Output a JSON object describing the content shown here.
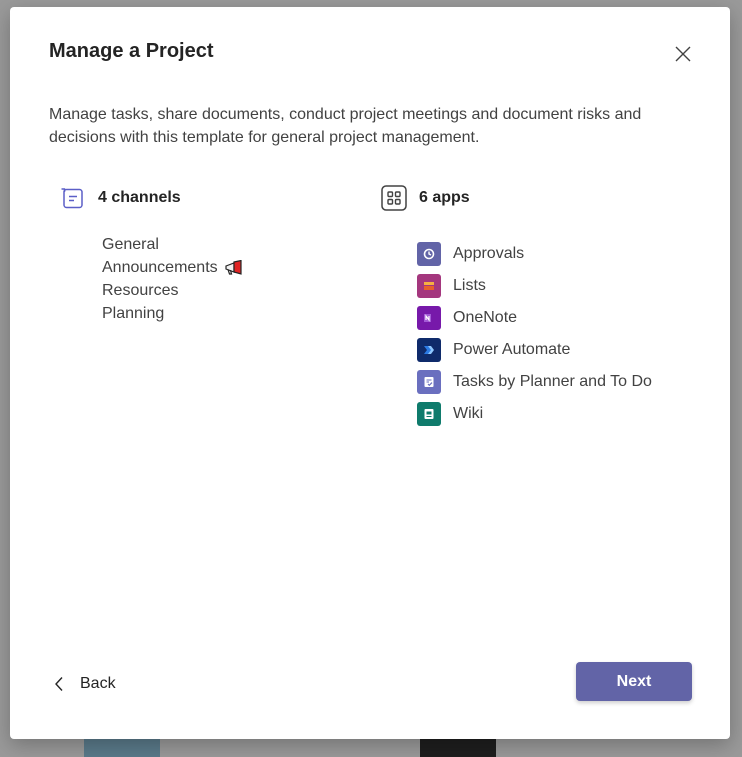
{
  "dialog": {
    "title": "Manage a Project",
    "description": "Manage tasks, share documents, conduct project meetings and document risks and decisions with this template for general project management."
  },
  "channels": {
    "heading": "4 channels",
    "items": [
      {
        "label": "General"
      },
      {
        "label": "Announcements",
        "icon": "megaphone-icon"
      },
      {
        "label": "Resources"
      },
      {
        "label": "Planning"
      }
    ]
  },
  "apps": {
    "heading": "6 apps",
    "items": [
      {
        "label": "Approvals",
        "icon": "approvals-icon",
        "color": "#6264a7"
      },
      {
        "label": "Lists",
        "icon": "lists-icon",
        "color": "#a4377e"
      },
      {
        "label": "OneNote",
        "icon": "onenote-icon",
        "color": "#7719aa"
      },
      {
        "label": "Power Automate",
        "icon": "power-automate-icon",
        "color": "#0f2b6b"
      },
      {
        "label": "Tasks by Planner and To Do",
        "icon": "tasks-icon",
        "color": "#6a6fbf"
      },
      {
        "label": "Wiki",
        "icon": "wiki-icon",
        "color": "#0f7b6c"
      }
    ]
  },
  "footer": {
    "back_label": "Back",
    "next_label": "Next"
  },
  "colors": {
    "accent": "#6264a7",
    "overlay": "#8a8a8a"
  }
}
